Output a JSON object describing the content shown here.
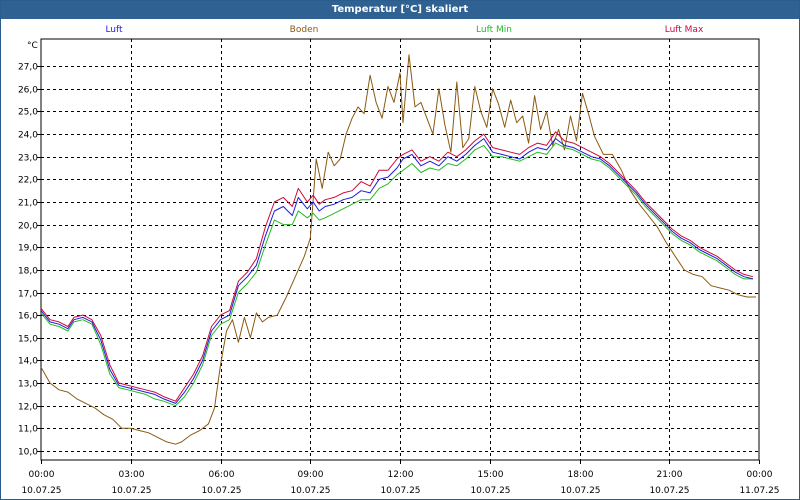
{
  "window": {
    "title": "Temperatur [°C] skaliert"
  },
  "colors": {
    "titlebar": "#2f6192",
    "grid": "#000000",
    "Luft": "#1c1ce0",
    "Boden": "#8b5a12",
    "Luft Min": "#22bb22",
    "Luft Max": "#cc0a3a"
  },
  "chart_data": {
    "type": "line",
    "title": "Temperatur [°C] skaliert",
    "ylabel": "°C",
    "xlabel": "",
    "ylim": [
      9.6,
      28.2
    ],
    "xlim": [
      0,
      24
    ],
    "grid": true,
    "legend_position": "top",
    "yticks": [
      10.0,
      11.0,
      12.0,
      13.0,
      14.0,
      15.0,
      16.0,
      17.0,
      18.0,
      19.0,
      20.0,
      21.0,
      22.0,
      23.0,
      24.0,
      25.0,
      26.0,
      27.0
    ],
    "ytick_labels": [
      "10,0",
      "11,0",
      "12,0",
      "13,0",
      "14,0",
      "15,0",
      "16,0",
      "17,0",
      "18,0",
      "19,0",
      "20,0",
      "21,0",
      "22,0",
      "23,0",
      "24,0",
      "25,0",
      "26,0",
      "27,0"
    ],
    "xticks": [
      {
        "x": 0,
        "time": "00:00",
        "date": "10.07.25"
      },
      {
        "x": 3,
        "time": "03:00",
        "date": "10.07.25"
      },
      {
        "x": 6,
        "time": "06:00",
        "date": "10.07.25"
      },
      {
        "x": 9,
        "time": "09:00",
        "date": "10.07.25"
      },
      {
        "x": 12,
        "time": "12:00",
        "date": "10.07.25"
      },
      {
        "x": 15,
        "time": "15:00",
        "date": "10.07.25"
      },
      {
        "x": 18,
        "time": "18:00",
        "date": "10.07.25"
      },
      {
        "x": 21,
        "time": "21:00",
        "date": "10.07.25"
      },
      {
        "x": 24,
        "time": "00:00",
        "date": "11.07.25"
      }
    ],
    "series": [
      {
        "name": "Luft",
        "x": [
          0,
          0.3,
          0.6,
          0.9,
          1.1,
          1.4,
          1.7,
          2.0,
          2.3,
          2.6,
          2.9,
          3.2,
          3.5,
          3.8,
          4.1,
          4.5,
          4.8,
          5.1,
          5.4,
          5.7,
          6.0,
          6.3,
          6.6,
          6.9,
          7.2,
          7.5,
          7.8,
          8.1,
          8.4,
          8.6,
          8.9,
          9.1,
          9.3,
          9.5,
          9.8,
          10.1,
          10.4,
          10.7,
          11.0,
          11.3,
          11.6,
          11.9,
          12.1,
          12.4,
          12.7,
          13.0,
          13.3,
          13.6,
          13.9,
          14.2,
          14.5,
          14.8,
          15.1,
          15.4,
          15.7,
          16.0,
          16.3,
          16.6,
          16.9,
          17.2,
          17.5,
          17.8,
          18.1,
          18.4,
          18.7,
          19.0,
          19.3,
          19.6,
          19.9,
          20.2,
          20.5,
          20.8,
          21.1,
          21.4,
          21.7,
          22.0,
          22.3,
          22.6,
          22.9,
          23.2,
          23.5,
          23.8
        ],
        "y": [
          16.2,
          15.7,
          15.6,
          15.4,
          15.8,
          15.9,
          15.7,
          14.9,
          13.6,
          12.9,
          12.8,
          12.7,
          12.6,
          12.5,
          12.3,
          12.1,
          12.6,
          13.2,
          14.0,
          15.3,
          15.8,
          16.0,
          17.3,
          17.7,
          18.2,
          19.5,
          20.6,
          20.8,
          20.4,
          21.2,
          20.7,
          21.0,
          20.6,
          20.8,
          20.9,
          21.1,
          21.2,
          21.5,
          21.4,
          22.0,
          22.1,
          22.5,
          22.9,
          23.1,
          22.6,
          22.8,
          22.6,
          23.0,
          22.8,
          23.1,
          23.5,
          23.8,
          23.2,
          23.1,
          23.0,
          22.9,
          23.2,
          23.4,
          23.3,
          23.8,
          23.5,
          23.4,
          23.2,
          23.0,
          22.9,
          22.6,
          22.2,
          21.8,
          21.4,
          20.9,
          20.5,
          20.1,
          19.7,
          19.4,
          19.2,
          18.9,
          18.7,
          18.5,
          18.2,
          17.9,
          17.7,
          17.6
        ]
      },
      {
        "name": "Luft Min",
        "x": [
          0,
          0.3,
          0.6,
          0.9,
          1.1,
          1.4,
          1.7,
          2.0,
          2.3,
          2.6,
          2.9,
          3.2,
          3.5,
          3.8,
          4.1,
          4.5,
          4.8,
          5.1,
          5.4,
          5.7,
          6.0,
          6.3,
          6.6,
          6.9,
          7.2,
          7.5,
          7.8,
          8.1,
          8.4,
          8.6,
          8.9,
          9.1,
          9.3,
          9.5,
          9.8,
          10.1,
          10.4,
          10.7,
          11.0,
          11.3,
          11.6,
          11.9,
          12.1,
          12.4,
          12.7,
          13.0,
          13.3,
          13.6,
          13.9,
          14.2,
          14.5,
          14.8,
          15.1,
          15.4,
          15.7,
          16.0,
          16.3,
          16.6,
          16.9,
          17.2,
          17.5,
          17.8,
          18.1,
          18.4,
          18.7,
          19.0,
          19.3,
          19.6,
          19.9,
          20.2,
          20.5,
          20.8,
          21.1,
          21.4,
          21.7,
          22.0,
          22.3,
          22.6,
          22.9,
          23.2,
          23.5,
          23.8
        ],
        "y": [
          16.1,
          15.6,
          15.5,
          15.3,
          15.7,
          15.8,
          15.6,
          14.7,
          13.4,
          12.8,
          12.7,
          12.6,
          12.5,
          12.3,
          12.2,
          12.0,
          12.4,
          13.0,
          13.8,
          15.1,
          15.6,
          15.8,
          17.0,
          17.4,
          17.9,
          19.1,
          20.2,
          20.0,
          20.0,
          20.6,
          20.3,
          20.5,
          20.2,
          20.3,
          20.5,
          20.7,
          20.9,
          21.1,
          21.1,
          21.6,
          21.8,
          22.2,
          22.4,
          22.7,
          22.3,
          22.5,
          22.4,
          22.7,
          22.6,
          22.9,
          23.3,
          23.5,
          23.0,
          23.0,
          22.9,
          22.8,
          23.0,
          23.2,
          23.1,
          23.6,
          23.4,
          23.3,
          23.1,
          22.9,
          22.8,
          22.5,
          22.1,
          21.7,
          21.3,
          20.8,
          20.4,
          20.0,
          19.6,
          19.3,
          19.1,
          18.8,
          18.6,
          18.4,
          18.1,
          17.8,
          17.6,
          17.6
        ]
      },
      {
        "name": "Luft Max",
        "x": [
          0,
          0.3,
          0.6,
          0.9,
          1.1,
          1.4,
          1.7,
          2.0,
          2.3,
          2.6,
          2.9,
          3.2,
          3.5,
          3.8,
          4.1,
          4.5,
          4.8,
          5.1,
          5.4,
          5.7,
          6.0,
          6.3,
          6.6,
          6.9,
          7.2,
          7.5,
          7.8,
          8.1,
          8.4,
          8.6,
          8.9,
          9.1,
          9.3,
          9.5,
          9.8,
          10.1,
          10.4,
          10.7,
          11.0,
          11.3,
          11.6,
          11.9,
          12.1,
          12.4,
          12.7,
          13.0,
          13.3,
          13.6,
          13.9,
          14.2,
          14.5,
          14.8,
          15.1,
          15.4,
          15.7,
          16.0,
          16.3,
          16.6,
          16.9,
          17.2,
          17.5,
          17.8,
          18.1,
          18.4,
          18.7,
          19.0,
          19.3,
          19.6,
          19.9,
          20.2,
          20.5,
          20.8,
          21.1,
          21.4,
          21.7,
          22.0,
          22.3,
          22.6,
          22.9,
          23.2,
          23.5,
          23.8
        ],
        "y": [
          16.3,
          15.8,
          15.7,
          15.5,
          15.9,
          16.0,
          15.8,
          15.1,
          13.8,
          13.0,
          12.9,
          12.8,
          12.7,
          12.6,
          12.4,
          12.2,
          12.8,
          13.4,
          14.2,
          15.5,
          16.0,
          16.2,
          17.5,
          17.9,
          18.5,
          19.9,
          21.0,
          21.2,
          20.8,
          21.6,
          21.0,
          21.3,
          20.9,
          21.1,
          21.2,
          21.4,
          21.5,
          21.9,
          21.7,
          22.4,
          22.4,
          22.9,
          23.1,
          23.3,
          22.8,
          23.0,
          22.8,
          23.2,
          23.0,
          23.3,
          23.7,
          24.0,
          23.4,
          23.3,
          23.2,
          23.1,
          23.4,
          23.6,
          23.5,
          24.1,
          23.7,
          23.6,
          23.4,
          23.2,
          23.0,
          22.7,
          22.3,
          21.9,
          21.5,
          21.0,
          20.6,
          20.2,
          19.8,
          19.5,
          19.3,
          19.0,
          18.8,
          18.6,
          18.3,
          18.0,
          17.8,
          17.7
        ]
      },
      {
        "name": "Boden",
        "x": [
          0,
          0.3,
          0.6,
          0.9,
          1.2,
          1.5,
          1.8,
          2.1,
          2.4,
          2.7,
          3.0,
          3.3,
          3.6,
          3.9,
          4.2,
          4.5,
          4.7,
          5.0,
          5.3,
          5.6,
          5.8,
          6.0,
          6.2,
          6.4,
          6.6,
          6.8,
          7.0,
          7.2,
          7.4,
          7.6,
          7.9,
          8.2,
          8.5,
          8.8,
          9.0,
          9.2,
          9.4,
          9.6,
          9.8,
          10.0,
          10.2,
          10.4,
          10.6,
          10.8,
          11.0,
          11.2,
          11.4,
          11.6,
          11.8,
          12.0,
          12.1,
          12.3,
          12.5,
          12.7,
          12.9,
          13.1,
          13.3,
          13.5,
          13.7,
          13.9,
          14.1,
          14.3,
          14.5,
          14.7,
          14.9,
          15.1,
          15.3,
          15.5,
          15.7,
          15.9,
          16.1,
          16.3,
          16.5,
          16.7,
          16.9,
          17.1,
          17.3,
          17.5,
          17.7,
          17.9,
          18.1,
          18.3,
          18.5,
          18.8,
          19.1,
          19.4,
          19.7,
          20.0,
          20.3,
          20.6,
          20.9,
          21.2,
          21.5,
          21.8,
          22.1,
          22.4,
          22.7,
          23.0,
          23.3,
          23.6,
          23.9
        ],
        "y": [
          13.7,
          13.0,
          12.7,
          12.6,
          12.3,
          12.1,
          11.9,
          11.6,
          11.4,
          11.0,
          11.0,
          10.9,
          10.8,
          10.6,
          10.4,
          10.3,
          10.4,
          10.7,
          10.9,
          11.2,
          11.9,
          13.8,
          15.3,
          15.8,
          14.8,
          15.9,
          15.0,
          16.1,
          15.7,
          15.9,
          16.0,
          16.8,
          17.7,
          18.6,
          19.4,
          22.9,
          21.6,
          23.2,
          22.6,
          22.9,
          24.0,
          24.7,
          25.2,
          24.9,
          26.6,
          25.4,
          24.7,
          26.1,
          25.4,
          26.7,
          24.5,
          27.5,
          25.2,
          25.4,
          24.7,
          24.0,
          26.0,
          24.4,
          23.2,
          26.3,
          23.4,
          23.8,
          26.1,
          25.0,
          24.3,
          26.0,
          25.3,
          24.3,
          25.5,
          24.5,
          24.8,
          23.6,
          25.7,
          24.2,
          25.0,
          23.5,
          24.2,
          23.3,
          24.8,
          23.7,
          25.8,
          24.9,
          23.9,
          23.1,
          23.1,
          22.4,
          21.5,
          20.9,
          20.4,
          19.9,
          19.2,
          18.6,
          18.0,
          17.8,
          17.7,
          17.3,
          17.2,
          17.1,
          16.9,
          16.8,
          16.8
        ]
      }
    ]
  }
}
